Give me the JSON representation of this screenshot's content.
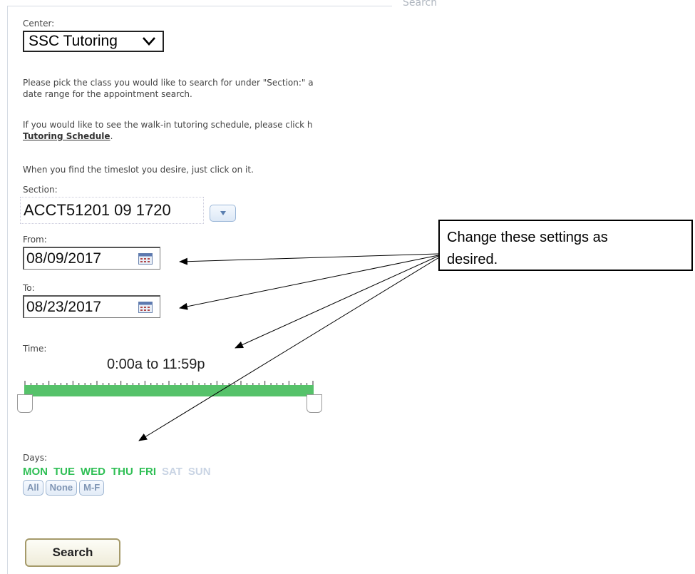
{
  "legend": "Search",
  "center": {
    "label": "Center:",
    "value": "SSC Tutoring"
  },
  "instructions": {
    "line1": "Please pick the class you would like to search for under \"Section:\" a",
    "line2": "date range for the appointment search.",
    "line3": "If you would like to see the walk-in tutoring schedule, please click h",
    "link": "Tutoring Schedule",
    "link_suffix": ".",
    "line5": "When you find the timeslot you desire, just click on it."
  },
  "section": {
    "label": "Section:",
    "value": "ACCT51201 09 1720"
  },
  "from": {
    "label": "From:",
    "value": "08/09/2017"
  },
  "to": {
    "label": "To:",
    "value": "08/23/2017"
  },
  "time": {
    "label": "Time:",
    "range": "0:00a to 11:59p",
    "start_fraction": 0.0,
    "end_fraction": 1.0
  },
  "days": {
    "label": "Days:",
    "items": [
      {
        "name": "MON",
        "selected": true
      },
      {
        "name": "TUE",
        "selected": true
      },
      {
        "name": "WED",
        "selected": true
      },
      {
        "name": "THU",
        "selected": true
      },
      {
        "name": "FRI",
        "selected": true
      },
      {
        "name": "SAT",
        "selected": false
      },
      {
        "name": "SUN",
        "selected": false
      }
    ],
    "buttons": [
      "All",
      "None",
      "M-F"
    ]
  },
  "search_button": "Search",
  "callout": {
    "line1": "Change these settings as",
    "line2": "desired."
  },
  "colors": {
    "selected_day": "#2fbf55",
    "unselected_day": "#c9d4e4",
    "slider": "#56c26a"
  }
}
